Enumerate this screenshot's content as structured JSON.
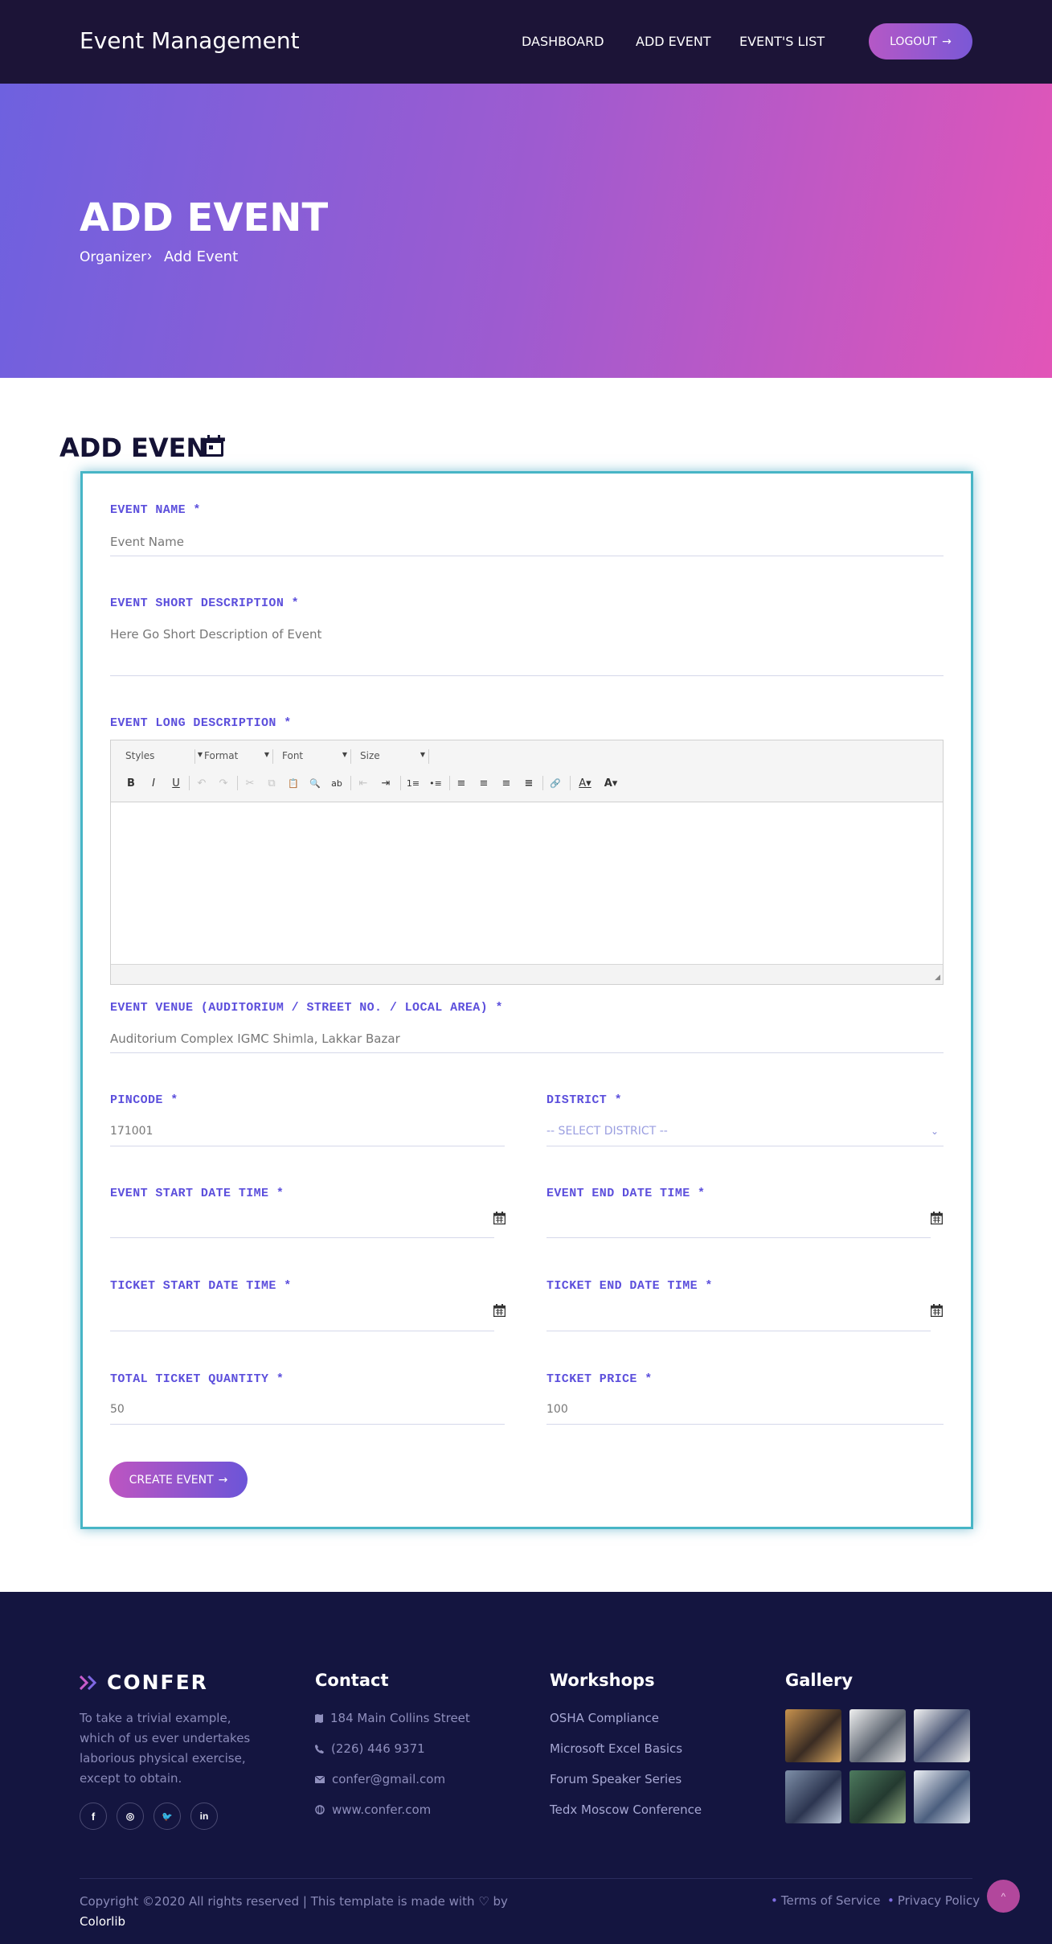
{
  "header": {
    "brand": "Event Management",
    "nav": [
      "DASHBOARD",
      "ADD EVENT",
      "EVENT'S LIST"
    ],
    "logout_label": "LOGOUT",
    "logout_icon": "arrow-right-icon"
  },
  "hero": {
    "title": "ADD EVENT",
    "breadcrumb": [
      "Organizer",
      "Add Event"
    ]
  },
  "section": {
    "title": "ADD EVENT",
    "icon": "calendar-icon"
  },
  "form": {
    "event_name": {
      "label": "EVENT NAME *",
      "placeholder": "Event Name"
    },
    "short_desc": {
      "label": "EVENT SHORT DESCRIPTION *",
      "placeholder": "Here Go Short Description of Event"
    },
    "long_desc": {
      "label": "EVENT LONG DESCRIPTION *",
      "combos": [
        "Styles",
        "Format",
        "Font",
        "Size"
      ],
      "tools": [
        "B",
        "I",
        "U",
        "↶",
        "↷",
        "✂",
        "⧉",
        "📋",
        "🔍",
        "ab",
        "⇤",
        "⇥",
        "1≡",
        "•≡",
        "≡",
        "≡",
        "≡",
        "≡",
        "🔗",
        "A▾",
        "A▾"
      ]
    },
    "venue": {
      "label": "EVENT VENUE (AUDITORIUM / STREET NO. / LOCAL AREA) *",
      "placeholder": "Auditorium Complex IGMC Shimla, Lakkar Bazar"
    },
    "pincode": {
      "label": "PINCODE *",
      "placeholder": "171001"
    },
    "district": {
      "label": "DISTRICT *",
      "selected": "-- SELECT DISTRICT --"
    },
    "event_start": {
      "label": "EVENT START DATE TIME *"
    },
    "event_end": {
      "label": "EVENT END DATE TIME *"
    },
    "ticket_start": {
      "label": "TICKET START DATE TIME *"
    },
    "ticket_end": {
      "label": "TICKET END DATE TIME *"
    },
    "ticket_qty": {
      "label": "TOTAL TICKET QUANTITY *",
      "placeholder": "50"
    },
    "ticket_price": {
      "label": "TICKET PRICE *",
      "placeholder": "100"
    },
    "submit_label": "CREATE EVENT"
  },
  "footer": {
    "logo": "CONFER",
    "about": "To take a trivial example, which of us ever undertakes laborious physical exercise, except to obtain.",
    "social": [
      "f",
      "◎",
      "🐦",
      "in"
    ],
    "contact_title": "Contact",
    "contact": [
      {
        "icon": "map-icon",
        "text": "184 Main Collins Street"
      },
      {
        "icon": "phone-icon",
        "text": "(226) 446 9371"
      },
      {
        "icon": "mail-icon",
        "text": "confer@gmail.com"
      },
      {
        "icon": "globe-icon",
        "text": "www.confer.com"
      }
    ],
    "workshops_title": "Workshops",
    "workshops": [
      "OSHA Compliance",
      "Microsoft Excel Basics",
      "Forum Speaker Series",
      "Tedx Moscow Conference"
    ],
    "gallery_title": "Gallery",
    "copyright": "Copyright ©2020 All rights reserved | This template is made with",
    "by": "by",
    "copy_link": "Colorlib",
    "links": [
      "Terms of Service",
      "Privacy Policy"
    ]
  }
}
